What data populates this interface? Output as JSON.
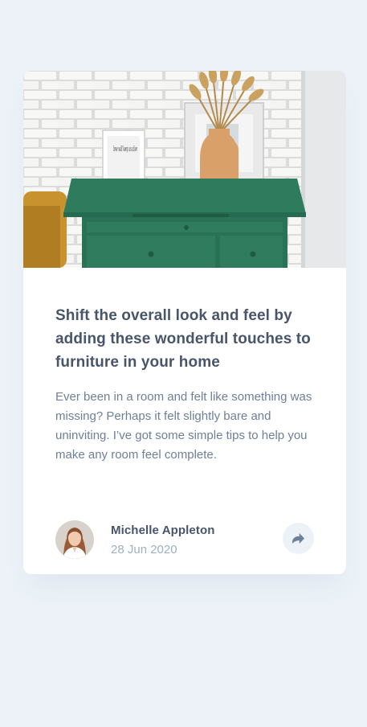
{
  "article": {
    "headline": "Shift the overall look and feel by adding these wonderful touches to furniture in your home",
    "excerpt": "Ever been in a room and felt like something was missing? Perhaps it felt slightly bare and uninviting. I’ve got some simple tips to help you make any room feel complete.",
    "image_icon": "drawers-photo",
    "frame_text": "love will keep us alive"
  },
  "author": {
    "name": "Michelle Appleton",
    "date": "28 Jun 2020",
    "avatar_icon": "avatar-photo"
  },
  "share": {
    "icon": "share-arrow-icon"
  },
  "colors": {
    "background": "#ecf2f8",
    "card": "#ffffff",
    "heading": "#48556a",
    "body": "#6e8098",
    "muted": "#9eafc2",
    "share_bg": "#ecf2f8",
    "share_icon": "#6e8098"
  }
}
